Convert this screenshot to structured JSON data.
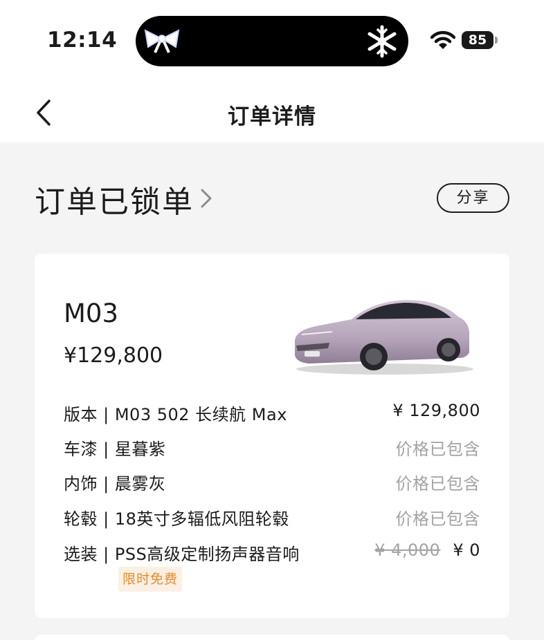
{
  "status_bar": {
    "time": "12:14",
    "battery": "85",
    "icons": [
      "bow-icon",
      "snowflake-icon",
      "wifi-icon",
      "battery-icon"
    ]
  },
  "nav": {
    "title": "订单详情",
    "back_icon": "chevron-left-icon"
  },
  "order": {
    "status": "订单已锁单",
    "status_icon": "chevron-right-icon",
    "share_label": "分享"
  },
  "car": {
    "model": "M03",
    "price": "¥129,800",
    "color_hex": "#b9a8bd",
    "specs": [
      {
        "label": "版本 | M03 502 长续航 Max",
        "value": "¥ 129,800"
      },
      {
        "label": "车漆 | 星暮紫",
        "value": "价格已包含"
      },
      {
        "label": "内饰 | 晨雾灰",
        "value": "价格已包含"
      },
      {
        "label": "轮毂 | 18英寸多辐低风阻轮毂",
        "value": "价格已包含"
      },
      {
        "label": "选装 | PSS高级定制扬声器音响",
        "original": "¥ 4,000",
        "value": "¥ 0",
        "tag": "限时免费"
      }
    ]
  },
  "colors": {
    "promo_text": "#e48a2c",
    "promo_bg": "#fbf0e3",
    "muted": "#a3a3a3"
  }
}
